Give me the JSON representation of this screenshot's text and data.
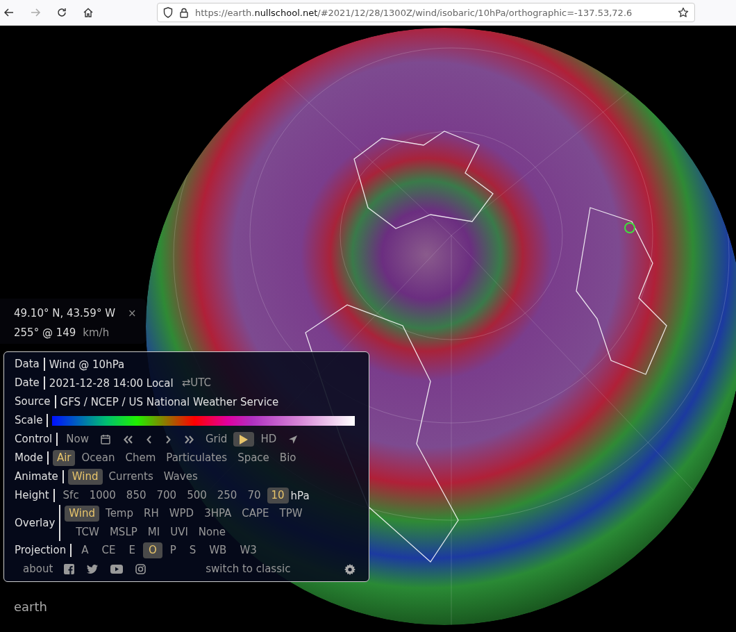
{
  "browser": {
    "url": "https://earth.**nullschool.net**/#2021/12/28/1300Z/wind/isobaric/10hPa/orthographic=-137.53,72.6"
  },
  "location": {
    "coordinates": "49.10° N, 43.59° W",
    "close": "×",
    "wind": "255° @ 149",
    "unit": "km/h"
  },
  "panel": {
    "data": {
      "label": "Data",
      "value": "Wind @ 10hPa"
    },
    "date": {
      "label": "Date",
      "value": "2021-12-28 14:00 Local",
      "toggle": "⇄UTC"
    },
    "source": {
      "label": "Source",
      "value": "GFS / NCEP / US National Weather Service"
    },
    "scale": {
      "label": "Scale"
    },
    "control": {
      "label": "Control",
      "items": [
        {
          "kind": "text",
          "label": "Now",
          "selected": false
        },
        {
          "kind": "calendar",
          "selected": false
        },
        {
          "kind": "rewind",
          "selected": false
        },
        {
          "kind": "back",
          "selected": false
        },
        {
          "kind": "forward",
          "selected": false
        },
        {
          "kind": "fast-forward",
          "selected": false
        },
        {
          "kind": "text",
          "label": "Grid",
          "selected": false
        },
        {
          "kind": "play",
          "selected": true
        },
        {
          "kind": "text",
          "label": "HD",
          "selected": false
        },
        {
          "kind": "locate",
          "selected": false
        }
      ]
    },
    "mode": {
      "label": "Mode",
      "options": [
        {
          "label": "Air",
          "selected": true
        },
        {
          "label": "Ocean",
          "selected": false
        },
        {
          "label": "Chem",
          "selected": false
        },
        {
          "label": "Particulates",
          "selected": false
        },
        {
          "label": "Space",
          "selected": false
        },
        {
          "label": "Bio",
          "selected": false
        }
      ]
    },
    "animate": {
      "label": "Animate",
      "options": [
        {
          "label": "Wind",
          "selected": true
        },
        {
          "label": "Currents",
          "selected": false
        },
        {
          "label": "Waves",
          "selected": false
        }
      ]
    },
    "height": {
      "label": "Height",
      "unit": "hPa",
      "options": [
        {
          "label": "Sfc",
          "selected": false
        },
        {
          "label": "1000",
          "selected": false
        },
        {
          "label": "850",
          "selected": false
        },
        {
          "label": "700",
          "selected": false
        },
        {
          "label": "500",
          "selected": false
        },
        {
          "label": "250",
          "selected": false
        },
        {
          "label": "70",
          "selected": false
        },
        {
          "label": "10",
          "selected": true
        }
      ]
    },
    "overlay": {
      "label": "Overlay",
      "lines": [
        [
          {
            "label": "Wind",
            "selected": true
          },
          {
            "label": "Temp",
            "selected": false
          },
          {
            "label": "RH",
            "selected": false
          },
          {
            "label": "WPD",
            "selected": false
          },
          {
            "label": "3HPA",
            "selected": false
          },
          {
            "label": "CAPE",
            "selected": false
          },
          {
            "label": "TPW",
            "selected": false
          }
        ],
        [
          {
            "label": "TCW",
            "selected": false
          },
          {
            "label": "MSLP",
            "selected": false
          },
          {
            "label": "MI",
            "selected": false
          },
          {
            "label": "UVI",
            "selected": false
          },
          {
            "label": "None",
            "selected": false
          }
        ]
      ]
    },
    "projection": {
      "label": "Projection",
      "options": [
        {
          "label": "A",
          "selected": false
        },
        {
          "label": "CE",
          "selected": false
        },
        {
          "label": "E",
          "selected": false
        },
        {
          "label": "O",
          "selected": true
        },
        {
          "label": "P",
          "selected": false
        },
        {
          "label": "S",
          "selected": false
        },
        {
          "label": "WB",
          "selected": false
        },
        {
          "label": "W3",
          "selected": false
        }
      ]
    },
    "footer": {
      "about": "about",
      "social": [
        {
          "kind": "facebook"
        },
        {
          "kind": "twitter"
        },
        {
          "kind": "youtube"
        },
        {
          "kind": "instagram"
        }
      ],
      "classic": "switch to classic"
    }
  },
  "logo": "earth"
}
